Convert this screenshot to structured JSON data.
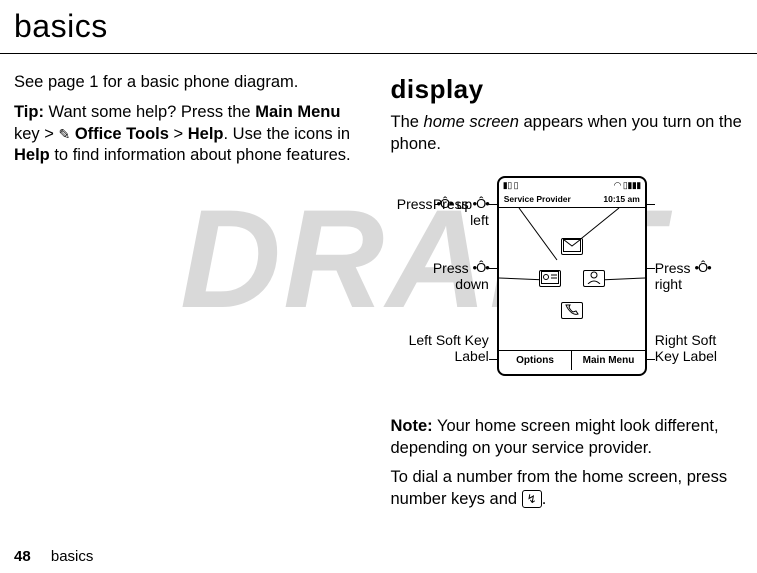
{
  "title": "basics",
  "watermark": "DRAFT",
  "left_col": {
    "p1": "See page 1 for a basic phone diagram.",
    "tip_label": "Tip:",
    "tip_a": " Want some help? Press the ",
    "main_menu_key": "Main Menu",
    "tip_b": " key > ",
    "office_tools": "Office Tools",
    "gt": " > ",
    "help": "Help",
    "tip_c": ". Use the icons in ",
    "help2": "Help",
    "tip_d": " to find information about phone features."
  },
  "right_col": {
    "subhead": "display",
    "p1_a": "The ",
    "p1_home": "home screen",
    "p1_b": " appears when you turn on the phone.",
    "note_label": "Note:",
    "note_body": " Your home screen might look different, depending on your service provider.",
    "p3_a": "To dial a number from the home screen, press number keys and ",
    "p3_b": "."
  },
  "screen": {
    "status_left": "▮▯ ▯",
    "status_right": "◠ ▯▮▮▮",
    "provider": "Service Provider",
    "time": "10:15 am",
    "soft_left": "Options",
    "soft_right": "Main Menu"
  },
  "labels": {
    "press_left_a": "Press ",
    "press_left_b": "left",
    "press_down_a": "Press ",
    "press_down_b": "down",
    "lsk_a": "Left Soft Key",
    "lsk_b": "Label",
    "press_up_a": "Press ",
    "press_up_b": " up",
    "press_right_a": "Press ",
    "press_right_b": "right",
    "rsk_a": "Right Soft",
    "rsk_b": "Key Label"
  },
  "footer": {
    "page": "48",
    "section": "basics"
  },
  "glyphs": {
    "nav": "•Ô•",
    "tool": "✎",
    "call": "↯"
  }
}
